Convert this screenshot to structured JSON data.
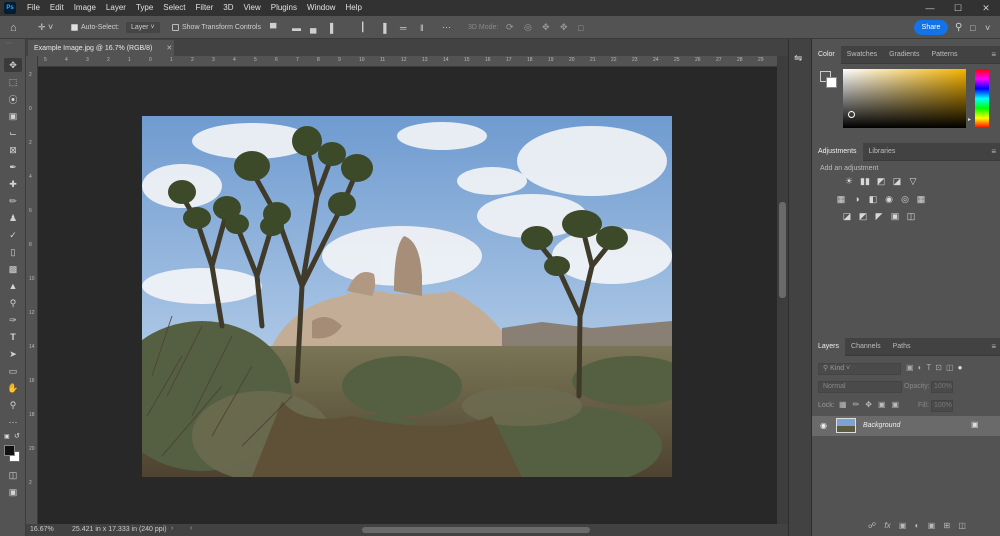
{
  "app": {
    "logo": "Ps"
  },
  "menubar": {
    "items": [
      "File",
      "Edit",
      "Image",
      "Layer",
      "Type",
      "Select",
      "Filter",
      "3D",
      "View",
      "Plugins",
      "Window",
      "Help"
    ]
  },
  "options": {
    "auto_select_label": "Auto-Select:",
    "auto_select_checked": true,
    "auto_select_value": "Layer",
    "transform_label": "Show Transform Controls",
    "mode_3d_label": "3D Mode:",
    "share_label": "Share"
  },
  "document": {
    "tab_title": "Example Image.jpg @ 16.7% (RGB/8)",
    "zoom": "16.67%",
    "size_info": "25.421 in x 17.333 in (240 ppi)"
  },
  "color_panel": {
    "tabs": [
      "Color",
      "Swatches",
      "Gradients",
      "Patterns"
    ],
    "active": "Color",
    "hue_color": "#f5b400"
  },
  "adjustments_panel": {
    "tabs": [
      "Adjustments",
      "Libraries"
    ],
    "add_label": "Add an adjustment",
    "row1": [
      "☀",
      "▮▮",
      "◩",
      "◪",
      "▽"
    ],
    "row2": [
      "▦",
      "◑",
      "◧",
      "◉",
      "◎",
      "▦"
    ],
    "row3": [
      "◪",
      "◩",
      "◤",
      "▣",
      "◫"
    ]
  },
  "layers_panel": {
    "tabs": [
      "Layers",
      "Channels",
      "Paths"
    ],
    "kind_placeholder": "Kind",
    "blend_mode": "Normal",
    "opacity_label": "Opacity:",
    "opacity_value": "100%",
    "lock_label": "Lock:",
    "fill_label": "Fill:",
    "fill_value": "100%",
    "layers": [
      {
        "name": "Background",
        "visible": true,
        "locked": true
      }
    ]
  },
  "ruler": {
    "h_ticks": [
      "5",
      "4",
      "3",
      "2",
      "1",
      "0",
      "1",
      "2",
      "3",
      "4",
      "5",
      "6",
      "7",
      "8",
      "9",
      "10",
      "11",
      "12",
      "13",
      "14",
      "15",
      "16",
      "17",
      "18",
      "19",
      "20",
      "21",
      "22",
      "23",
      "24",
      "25",
      "26",
      "27",
      "28",
      "29",
      "30"
    ],
    "v_ticks": [
      "2",
      "0",
      "2",
      "4",
      "6",
      "8",
      "10",
      "12",
      "14",
      "16",
      "18",
      "20",
      "2"
    ]
  }
}
